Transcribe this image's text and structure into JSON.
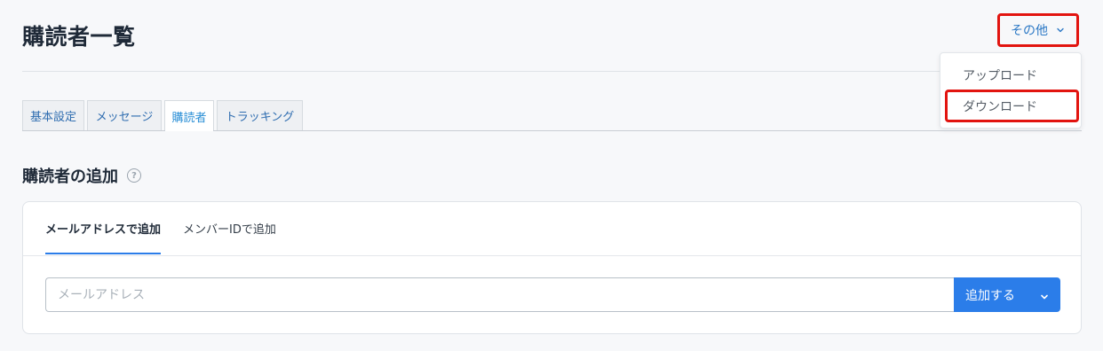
{
  "header": {
    "title": "購読者一覧",
    "more_label": "その他"
  },
  "more_menu": {
    "items": [
      "アップロード",
      "ダウンロード"
    ]
  },
  "tabs": [
    {
      "label": "基本設定",
      "active": false
    },
    {
      "label": "メッセージ",
      "active": false
    },
    {
      "label": "購読者",
      "active": true
    },
    {
      "label": "トラッキング",
      "active": false
    }
  ],
  "section": {
    "title": "購読者の追加",
    "help_icon": "?"
  },
  "add_card": {
    "subtabs": [
      "メールアドレスで追加",
      "メンバーIDで追加"
    ],
    "email_placeholder": "メールアドレス",
    "email_value": "",
    "add_button": "追加する"
  },
  "colors": {
    "accent": "#2b7de9",
    "highlight_border": "#e2140f"
  }
}
